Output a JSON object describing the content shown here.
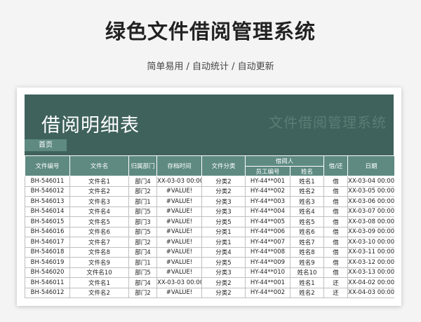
{
  "header": {
    "title": "绿色文件借阅管理系统",
    "subtitle": "简单易用 / 自动统计 / 自动更新"
  },
  "banner": {
    "title": "借阅明细表",
    "watermark": "文件借阅管理系统",
    "home_tab": "首页"
  },
  "table": {
    "headers": {
      "file_no": "文件编号",
      "file_name": "文件名",
      "dept": "归属部门",
      "archive_time": "存档时间",
      "category": "文件分类",
      "borrower": "借阅人",
      "employee_no": "员工编号",
      "name": "姓名",
      "borrow_return": "借/还",
      "date": "日期"
    },
    "rows": [
      [
        "BH-546011",
        "文件名1",
        "部门4",
        "XX-03-03 00:00:00",
        "分类2",
        "HY-44**001",
        "姓名1",
        "借",
        "XX-03-04 00:00:00"
      ],
      [
        "BH-546012",
        "文件名2",
        "部门2",
        "#VALUE!",
        "分类2",
        "HY-44**002",
        "姓名2",
        "借",
        "XX-03-05 00:00:00"
      ],
      [
        "BH-546013",
        "文件名3",
        "部门1",
        "#VALUE!",
        "分类3",
        "HY-44**003",
        "姓名3",
        "借",
        "XX-03-06 00:00:00"
      ],
      [
        "BH-546014",
        "文件名4",
        "部门5",
        "#VALUE!",
        "分类3",
        "HY-44**004",
        "姓名4",
        "借",
        "XX-03-07 00:00:00"
      ],
      [
        "BH-546015",
        "文件名5",
        "部门3",
        "#VALUE!",
        "分类5",
        "HY-44**005",
        "姓名5",
        "借",
        "XX-03-08 00:00:00"
      ],
      [
        "BH-546016",
        "文件名6",
        "部门5",
        "#VALUE!",
        "分类1",
        "HY-44**006",
        "姓名6",
        "借",
        "XX-03-09 00:00:00"
      ],
      [
        "BH-546017",
        "文件名7",
        "部门2",
        "#VALUE!",
        "分类1",
        "HY-44**007",
        "姓名7",
        "借",
        "XX-03-10 00:00:00"
      ],
      [
        "BH-546018",
        "文件名8",
        "部门4",
        "#VALUE!",
        "分类4",
        "HY-44**008",
        "姓名8",
        "借",
        "XX-03-11 00:00:00"
      ],
      [
        "BH-546019",
        "文件名9",
        "部门1",
        "#VALUE!",
        "分类5",
        "HY-44**009",
        "姓名9",
        "借",
        "XX-03-12 00:00:00"
      ],
      [
        "BH-546020",
        "文件名10",
        "部门5",
        "#VALUE!",
        "分类3",
        "HY-44**010",
        "姓名10",
        "借",
        "XX-03-13 00:00:00"
      ],
      [
        "BH-546011",
        "文件名1",
        "部门4",
        "XX-03-03 00:00:00",
        "分类2",
        "HY-44**001",
        "姓名1",
        "还",
        "XX-04-02 00:00:00"
      ],
      [
        "BH-546012",
        "文件名2",
        "部门2",
        "#VALUE!",
        "分类2",
        "HY-44**002",
        "姓名2",
        "还",
        "XX-04-03 00:00:00"
      ]
    ]
  }
}
